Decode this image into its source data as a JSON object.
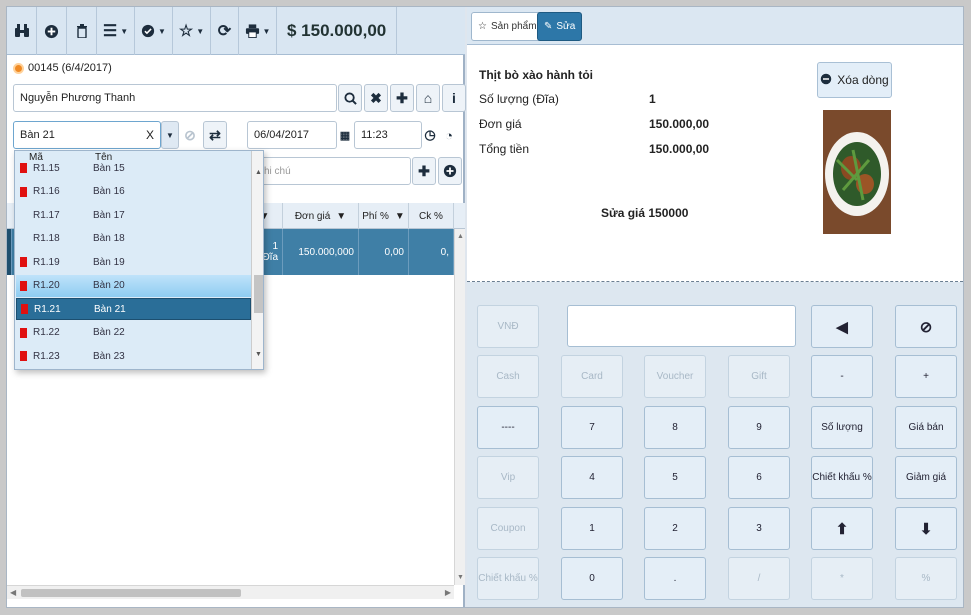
{
  "toolbar": {
    "total": "$ 150.000,00"
  },
  "order": {
    "label": "00145 (6/4/2017)"
  },
  "customer": {
    "name": "Nguyễn Phương Thanh"
  },
  "table_select": {
    "value": "Bàn 21",
    "clear": "X"
  },
  "date": "06/04/2017",
  "time": "11:23",
  "note_placeholder": "hi chú",
  "dropdown": {
    "col_code": "Mã",
    "col_name": "Tên",
    "rows": [
      {
        "code": "R1.15",
        "name": "Bàn 15",
        "flag": true
      },
      {
        "code": "R1.16",
        "name": "Bàn 16",
        "flag": true
      },
      {
        "code": "R1.17",
        "name": "Bàn 17",
        "flag": false
      },
      {
        "code": "R1.18",
        "name": "Bàn 18",
        "flag": false
      },
      {
        "code": "R1.19",
        "name": "Bàn 19",
        "flag": true
      },
      {
        "code": "R1.20",
        "name": "Bàn 20",
        "flag": true
      },
      {
        "code": "R1.21",
        "name": "Bàn 21",
        "flag": true
      },
      {
        "code": "R1.22",
        "name": "Bàn 22",
        "flag": true
      },
      {
        "code": "R1.23",
        "name": "Bàn 23",
        "flag": true
      }
    ]
  },
  "grid": {
    "headers": {
      "price": "Đơn giá",
      "fee": "Phí %",
      "discount": "Ck %"
    },
    "row": {
      "qty": "1",
      "unit": "Đĩa",
      "price": "150.000,000",
      "fee": "0,00",
      "discount": "0,"
    }
  },
  "tabs": {
    "products": "Sản phẩm",
    "edit": "Sửa"
  },
  "item": {
    "name": "Thịt bò xào hành tỏi",
    "qty_label": "Số lượng (Đĩa)",
    "qty_value": "1",
    "price_label": "Đơn giá",
    "price_value": "150.000,00",
    "total_label": "Tổng tiền",
    "total_value": "150.000,00",
    "edit_note": "Sửa giá 150000",
    "delete_label": "Xóa dòng"
  },
  "keypad": {
    "vnd": "VNĐ",
    "cash": "Cash",
    "card": "Card",
    "voucher": "Voucher",
    "gift": "Gift",
    "dash": "----",
    "vip": "Vip",
    "coupon": "Coupon",
    "discount_pct": "Chiết khấu %",
    "k7": "7",
    "k8": "8",
    "k9": "9",
    "k4": "4",
    "k5": "5",
    "k6": "6",
    "k1": "1",
    "k2": "2",
    "k3": "3",
    "k0": "0",
    "dot": ".",
    "slash": "/",
    "star": "*",
    "pct": "%",
    "minus": "-",
    "plus": "+",
    "quantity": "Số lượng",
    "sale_price": "Giá bán",
    "discount2": "Chiết khấu %",
    "reduce": "Giảm giá"
  }
}
